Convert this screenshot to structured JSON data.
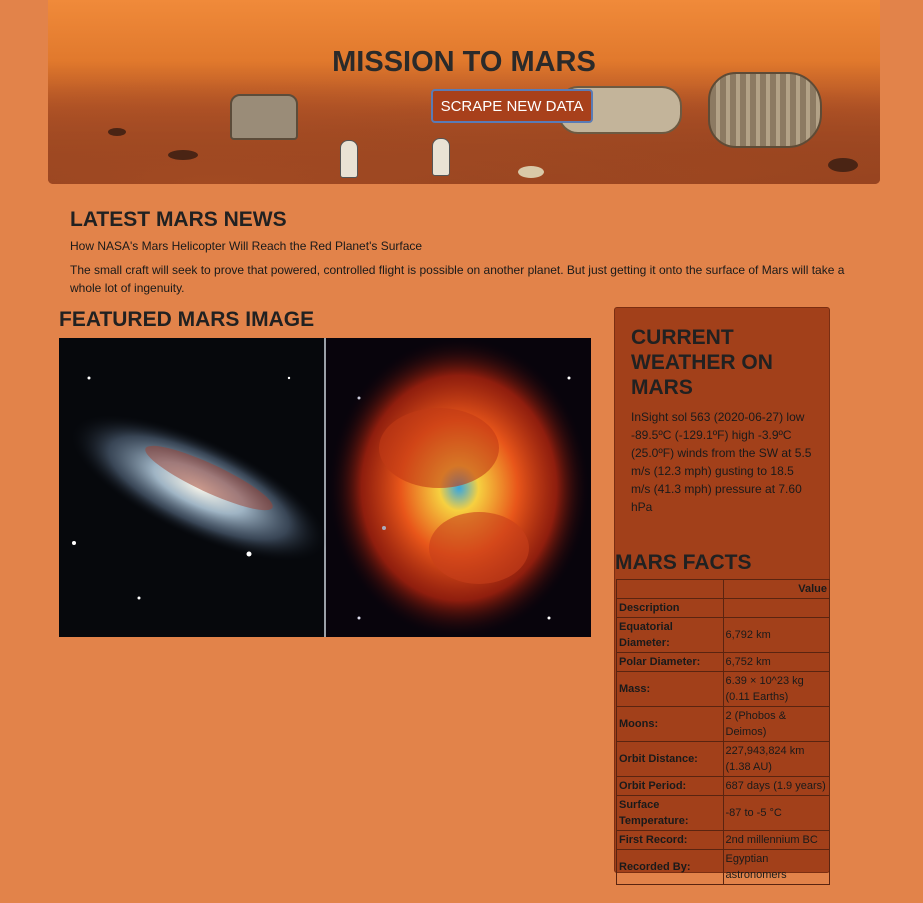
{
  "header": {
    "title": "MISSION TO MARS",
    "scrape_button": "SCRAPE NEW DATA"
  },
  "news": {
    "heading": "LATEST MARS NEWS",
    "title": "How NASA's Mars Helicopter Will Reach the Red Planet's Surface",
    "teaser": "The small craft will seek to prove that powered, controlled flight is possible on another planet. But just getting it onto the surface of Mars will take a whole lot of ingenuity."
  },
  "featured": {
    "heading": "FEATURED MARS IMAGE",
    "image_subject": "galaxy image"
  },
  "weather": {
    "heading": "CURRENT WEATHER ON MARS",
    "text": "InSight sol 563 (2020-06-27) low -89.5ºC (-129.1ºF) high -3.9ºC (25.0ºF) winds from the SW at 5.5 m/s (12.3 mph) gusting to 18.5 m/s (41.3 mph) pressure at 7.60 hPa"
  },
  "facts": {
    "heading": "MARS FACTS",
    "value_header": "Value",
    "index_header": "Description",
    "rows": [
      {
        "label": "Equatorial Diameter:",
        "value": "6,792 km"
      },
      {
        "label": "Polar Diameter:",
        "value": "6,752 km"
      },
      {
        "label": "Mass:",
        "value": "6.39 × 10^23 kg (0.11 Earths)"
      },
      {
        "label": "Moons:",
        "value": "2 (Phobos & Deimos)"
      },
      {
        "label": "Orbit Distance:",
        "value": "227,943,824 km (1.38 AU)"
      },
      {
        "label": "Orbit Period:",
        "value": "687 days (1.9 years)"
      },
      {
        "label": "Surface Temperature:",
        "value": "-87 to -5 °C"
      },
      {
        "label": "First Record:",
        "value": "2nd millennium BC"
      },
      {
        "label": "Recorded By:",
        "value": "Egyptian astronomers"
      }
    ]
  },
  "colors": {
    "page_background": "#e2834a",
    "sidebar_background": "#a2401a",
    "button_background": "#a8401b"
  }
}
